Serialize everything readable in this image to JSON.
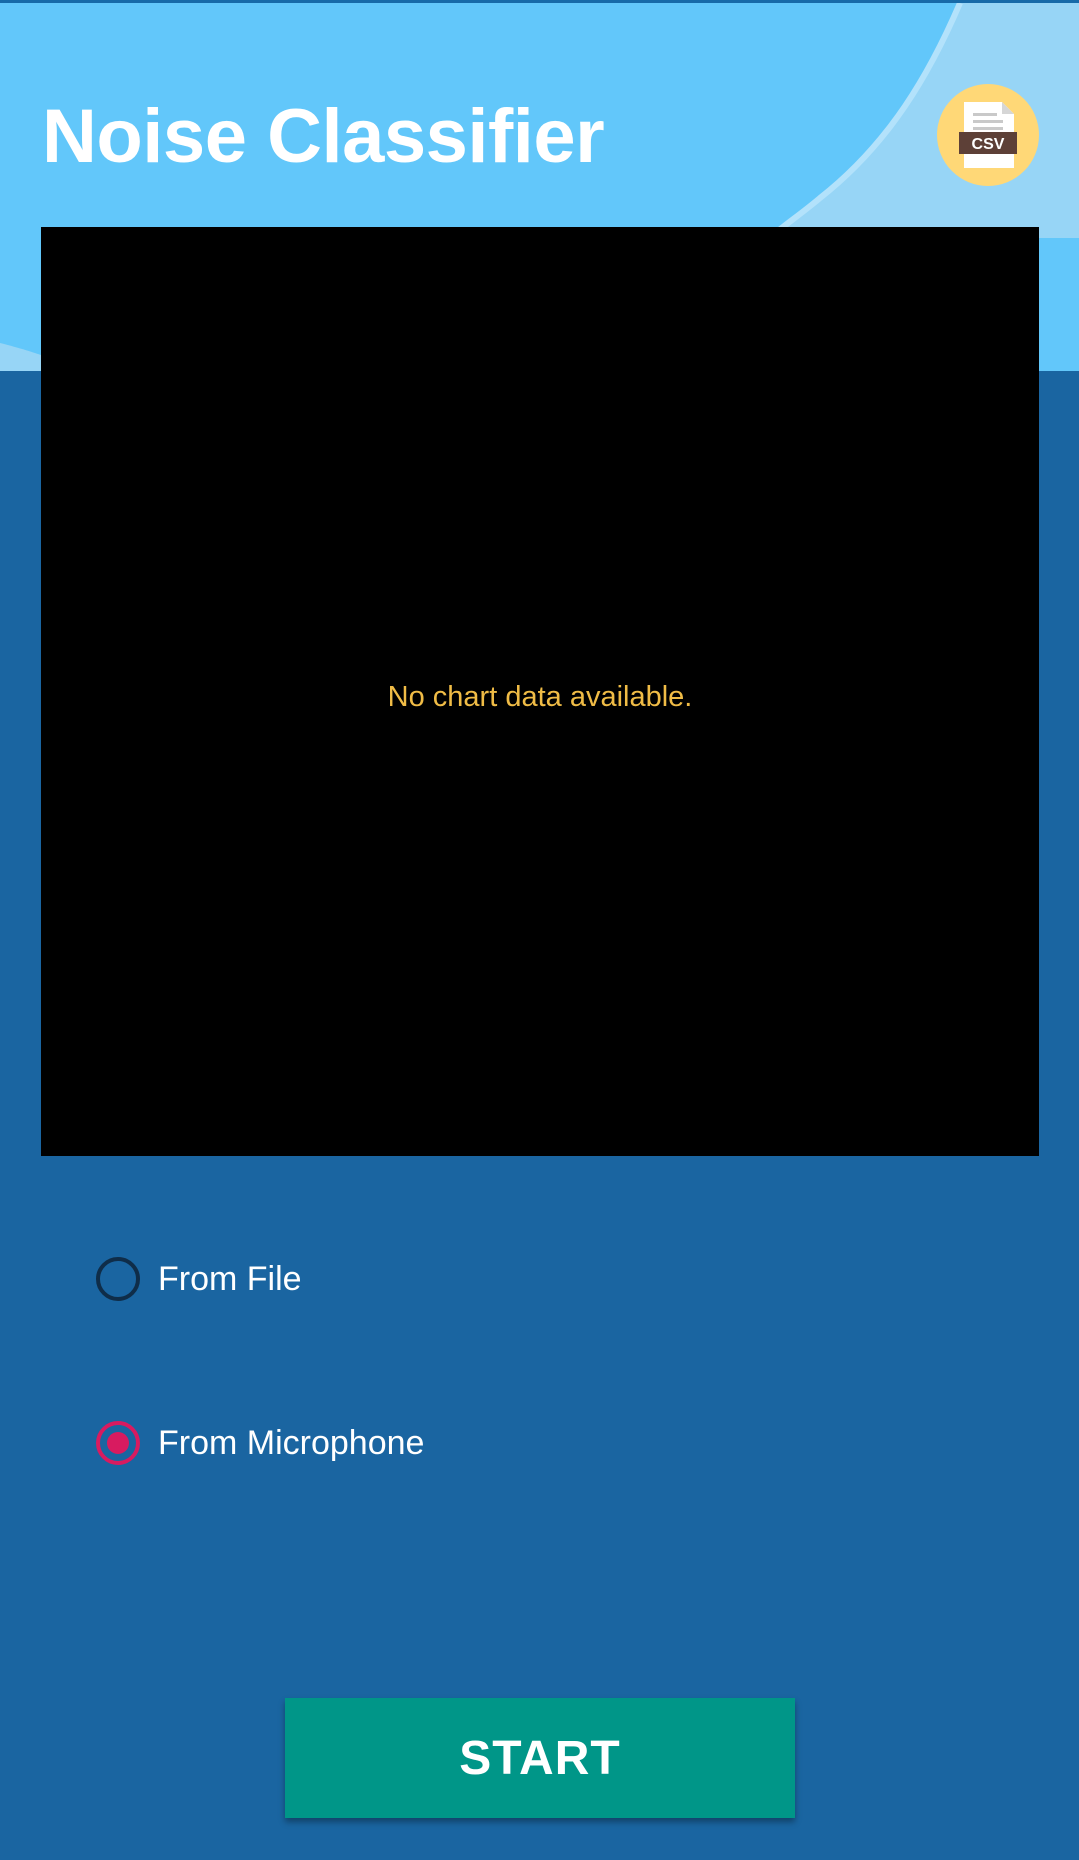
{
  "app": {
    "title": "Noise Classifier"
  },
  "toolbar": {
    "export_icon": "csv-file-icon",
    "export_icon_text": "CSV"
  },
  "chart": {
    "empty_message": "No chart data available."
  },
  "source": {
    "options": [
      {
        "label": "From File",
        "selected": false
      },
      {
        "label": "From Microphone",
        "selected": true
      }
    ]
  },
  "actions": {
    "start_label": "START"
  },
  "colors": {
    "header_light_blue": "#62c7fa",
    "background_blue": "#1a65a1",
    "accent_pink": "#d81b60",
    "start_teal": "#009688",
    "empty_text_amber": "#f0bc46",
    "csv_badge_yellow": "#ffd877"
  }
}
